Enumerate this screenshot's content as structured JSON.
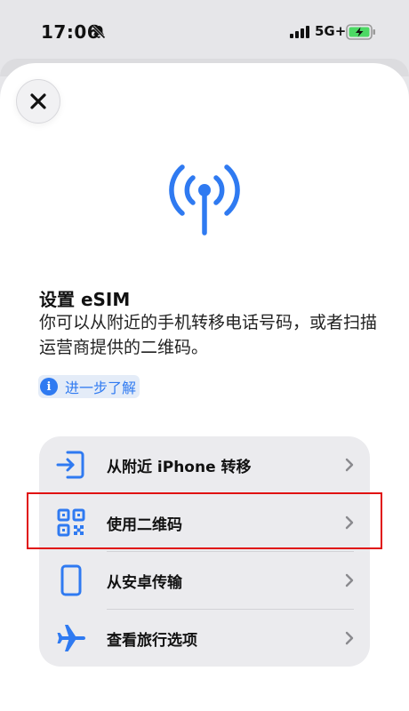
{
  "status_bar": {
    "time": "17:06",
    "network": "5G+",
    "icons": [
      "bell-slash-icon",
      "signal-icon",
      "battery-charging-icon"
    ]
  },
  "sheet": {
    "close_icon": "close-icon",
    "hero_icon": "antenna-icon",
    "title": "设置 eSIM",
    "description": "你可以从附近的手机转移电话号码，或者扫描运营商提供的二维码。",
    "learn_more": {
      "icon": "info-icon",
      "label": "进一步了解"
    }
  },
  "options": [
    {
      "label": "从附近 iPhone 转移",
      "icon": "transfer-in-icon"
    },
    {
      "label": "使用二维码",
      "icon": "qr-code-icon",
      "highlighted": true
    },
    {
      "label": "从安卓传输",
      "icon": "phone-icon"
    },
    {
      "label": "查看旅行选项",
      "icon": "airplane-icon"
    }
  ],
  "colors": {
    "accent": "#2f7af1",
    "highlight_border": "#e01010",
    "battery_fill": "#4cd964"
  }
}
